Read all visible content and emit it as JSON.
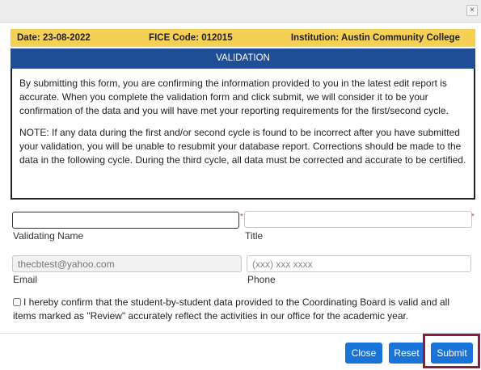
{
  "window": {
    "close_glyph": "×"
  },
  "info_bar": {
    "date": "Date: 23-08-2022",
    "fice_code": "FICE Code: 012015",
    "institution": "Institution: Austin Community College"
  },
  "section": {
    "title": "VALIDATION"
  },
  "message": {
    "paragraph1": "By submitting this form, you are confirming the information provided to you in the latest edit report is accurate. When you complete the validation form and click submit, we will consider it to be your confirmation of the data and you will have met your reporting requirements for the first/second cycle.",
    "paragraph2": "NOTE: If any data during the first and/or second cycle is found to be incorrect after you have submitted your validation, you will be unable to resubmit your database report. Corrections should be made to the data in the following cycle. During the third cycle, all data must be corrected and accurate to be certified."
  },
  "form": {
    "validating_name": {
      "label": "Validating Name",
      "value": "",
      "required_mark": "*"
    },
    "title": {
      "label": "Title",
      "value": "",
      "required_mark": "*"
    },
    "email": {
      "label": "Email",
      "value": "thecbtest@yahoo.com"
    },
    "phone": {
      "label": "Phone",
      "placeholder": "(xxx) xxx xxxx",
      "value": ""
    },
    "confirm": {
      "checked": false,
      "text": "I hereby confirm that the student-by-student data provided to the Coordinating Board is valid and all items marked as \"Review\" accurately reflect the activities in our office for the academic year."
    }
  },
  "buttons": {
    "close": "Close",
    "reset": "Reset",
    "submit": "Submit"
  },
  "icons": {
    "close": "close-icon"
  },
  "colors": {
    "info_bar": "#f6cf55",
    "section_header": "#1f4e96",
    "button": "#1a73d9",
    "highlight": "#8b1c3b",
    "required": "#e04343"
  }
}
